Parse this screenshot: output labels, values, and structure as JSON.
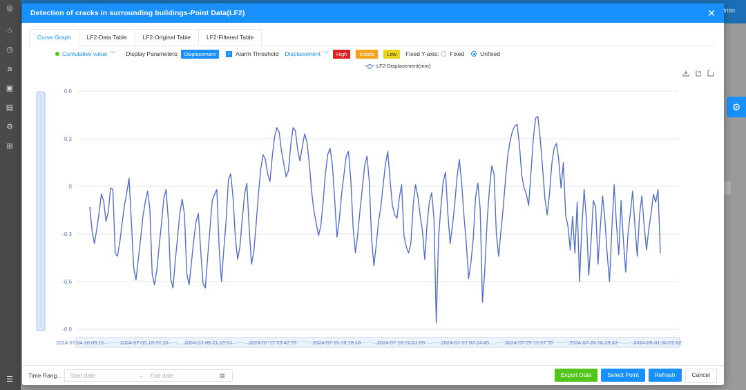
{
  "background": {
    "user_label": "Admin",
    "sidebar_icons": [
      "home-icon",
      "clock-icon",
      "user-icon",
      "building-icon",
      "calculator-icon",
      "gear-icon",
      "org-chart-icon",
      "menu-icon"
    ]
  },
  "modal": {
    "title": "Detection of cracks in surrounding buildings-Point Data(LF2)",
    "close_label": "✕"
  },
  "tabs": [
    {
      "label": "Curve Graph",
      "active": true
    },
    {
      "label": "LF2-Data Table",
      "active": false
    },
    {
      "label": "LF2-Original Table",
      "active": false
    },
    {
      "label": "LF2-Filtered Table",
      "active": false
    }
  ],
  "params": {
    "mode_label": "Cumulative value",
    "display_label": "Display Parameters:",
    "display_tag": "Displacement",
    "alarm_label": "Alarm Threshold",
    "alarm_param": "Displacement",
    "levels": {
      "high": "High",
      "middle": "Middle",
      "low": "Low"
    },
    "fixed_y_label": "Fixed Y-axis:",
    "fixed_label": "Fixed",
    "unfixed_label": "Unfixed",
    "unfixed_selected": true
  },
  "colors": {
    "primary": "#1890ff",
    "series": "#5470c6",
    "high": "#e02020",
    "middle": "#f7a21a",
    "low": "#e8d31b",
    "export": "#52c41a"
  },
  "chart_data": {
    "type": "line",
    "ylim": [
      -0.9,
      0.6
    ],
    "y_ticks": [
      "0.6",
      "0.3",
      "0",
      "-0.3",
      "-0.6",
      "-0.9"
    ],
    "x_ticks": [
      "2024-07-04 10:05:10",
      "2024-07-05 15:37:35",
      "2024-07-08 21:10:01",
      "2024-07-12 03:42:53",
      "2024-07-15 16:18:16",
      "2024-07-18 22:51:05",
      "2024-07-22 07:24:45",
      "2024-07-25 12:57:00",
      "2024-07-28 18:29:33",
      "2024-08-01 00:02:02"
    ],
    "series": [
      {
        "name": "LF2-Displacement(mm)",
        "values": [
          -0.13,
          -0.28,
          -0.36,
          -0.27,
          -0.17,
          -0.05,
          -0.09,
          -0.22,
          -0.16,
          -0.01,
          -0.02,
          -0.42,
          -0.44,
          -0.35,
          -0.23,
          -0.12,
          -0.04,
          0.05,
          -0.22,
          -0.51,
          -0.59,
          -0.46,
          -0.33,
          -0.19,
          -0.1,
          -0.03,
          -0.14,
          -0.55,
          -0.62,
          -0.53,
          -0.38,
          -0.24,
          -0.08,
          -0.02,
          -0.21,
          -0.58,
          -0.64,
          -0.47,
          -0.32,
          -0.17,
          -0.08,
          -0.18,
          -0.55,
          -0.62,
          -0.48,
          -0.34,
          -0.22,
          -0.17,
          -0.4,
          -0.61,
          -0.64,
          -0.45,
          -0.27,
          -0.09,
          -0.05,
          -0.02,
          -0.39,
          -0.6,
          -0.4,
          -0.22,
          0.04,
          0.08,
          -0.07,
          -0.32,
          -0.46,
          -0.38,
          -0.21,
          -0.05,
          0.02,
          -0.26,
          -0.49,
          -0.41,
          -0.24,
          -0.05,
          0.11,
          0.2,
          0.17,
          0.08,
          0.03,
          0.19,
          0.31,
          0.37,
          0.34,
          0.22,
          0.14,
          0.06,
          0.1,
          0.26,
          0.37,
          0.35,
          0.23,
          0.16,
          0.25,
          0.33,
          0.28,
          0.15,
          -0.03,
          -0.15,
          -0.23,
          -0.31,
          -0.25,
          -0.1,
          0.08,
          0.2,
          0.24,
          0.14,
          -0.08,
          -0.32,
          -0.21,
          -0.05,
          0.07,
          0.19,
          0.22,
          0.04,
          -0.26,
          -0.42,
          -0.3,
          -0.15,
          -0.01,
          0.13,
          0.19,
          0.03,
          -0.33,
          -0.5,
          -0.37,
          -0.22,
          -0.13,
          0.01,
          0.14,
          0.22,
          0.04,
          -0.12,
          -0.18,
          -0.2,
          -0.07,
          0.01,
          -0.31,
          -0.38,
          -0.42,
          -0.36,
          -0.12,
          0.01,
          -0.06,
          -0.18,
          -0.28,
          -0.46,
          -0.24,
          -0.1,
          -0.04,
          -0.2,
          -0.86,
          -0.32,
          -0.13,
          0.03,
          0.09,
          -0.17,
          -0.36,
          -0.25,
          -0.11,
          0.06,
          0.17,
          0.02,
          -0.19,
          -0.36,
          -0.58,
          -0.48,
          -0.33,
          -0.07,
          0.02,
          -0.14,
          -0.73,
          -0.53,
          -0.22,
          -0.02,
          0.13,
          0.08,
          -0.3,
          -0.44,
          -0.28,
          -0.13,
          0.05,
          0.2,
          0.29,
          0.35,
          0.38,
          0.39,
          0.26,
          0.07,
          -0.01,
          -0.05,
          -0.12,
          0.09,
          0.3,
          0.43,
          0.44,
          0.3,
          0.12,
          -0.07,
          -0.18,
          -0.05,
          0.14,
          0.24,
          0.27,
          0.17,
          -0.01,
          0.15,
          -0.18,
          -0.25,
          -0.4,
          -0.19,
          -0.42,
          -0.1,
          -0.6,
          -0.26,
          -0.02,
          -0.21,
          -0.56,
          -0.35,
          -0.09,
          -0.13,
          -0.49,
          -0.26,
          -0.06,
          -0.21,
          -0.43,
          -0.6,
          -0.27,
          0.01,
          -0.24,
          -0.43,
          -0.09,
          -0.34,
          -0.54,
          -0.3,
          -0.17,
          -0.03,
          -0.25,
          -0.44,
          -0.18,
          -0.06,
          -0.25,
          -0.4,
          -0.27,
          -0.17,
          -0.05,
          -0.1,
          -0.02,
          -0.42
        ]
      }
    ]
  },
  "footer": {
    "time_range_label": "Time Rang...",
    "start_placeholder": "Start date",
    "end_placeholder": "End date",
    "buttons": {
      "export": "Export Data",
      "select_point": "Select Point",
      "refresh": "Refresh",
      "cancel": "Cancel"
    }
  }
}
